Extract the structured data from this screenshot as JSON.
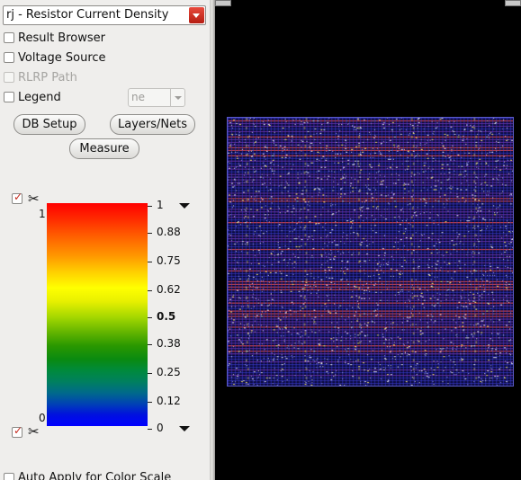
{
  "result_selector": {
    "value": "rj - Resistor Current Density"
  },
  "options": [
    {
      "label": "Result Browser",
      "enabled": true,
      "checked": false
    },
    {
      "label": "Voltage Source",
      "enabled": true,
      "checked": false
    },
    {
      "label": "RLRP Path",
      "enabled": false,
      "checked": false
    },
    {
      "label": "Legend",
      "enabled": true,
      "checked": false
    }
  ],
  "legend_combo": {
    "value": "ne"
  },
  "buttons": {
    "db_setup": "DB Setup",
    "layers_nets": "Layers/Nets",
    "measure": "Measure"
  },
  "color_scale": {
    "upper_end": "1",
    "lower_end": "0",
    "ticks": [
      "1",
      "0.88",
      "0.75",
      "0.62",
      "0.5",
      "0.38",
      "0.25",
      "0.12",
      "0"
    ],
    "tick_values": [
      1,
      0.88,
      0.75,
      0.62,
      0.5,
      0.38,
      0.25,
      0.12,
      0
    ],
    "bold_tick": "0.5",
    "upper_clip_checked": true,
    "lower_clip_checked": true
  },
  "auto_apply": {
    "label": "Auto Apply for Color Scale",
    "checked": false
  },
  "colors": {
    "canvas_background": "#000000",
    "panel_background": "#efeeec",
    "metal_horizontal": "#6a2f9a",
    "metal_vertical": "#3a3ad8",
    "hot_spot": "#e84a4a",
    "via": "#c8c8d8",
    "warm_via": "#e0d060"
  },
  "icons": {
    "dropdown": "chevron-down-icon",
    "clip": "scissors-icon",
    "scale_menu": "triangle-down-icon"
  }
}
